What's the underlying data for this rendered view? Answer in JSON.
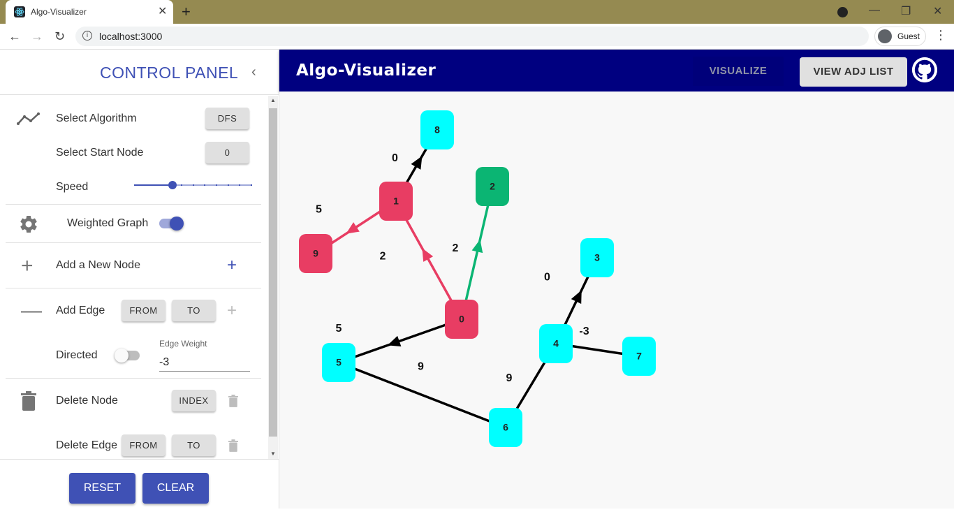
{
  "browser": {
    "tab_title": "Algo-Visualizer",
    "url": "localhost:3000",
    "profile_label": "Guest"
  },
  "control_panel": {
    "title": "CONTROL PANEL",
    "select_algorithm_label": "Select Algorithm",
    "algorithm_value": "DFS",
    "select_start_node_label": "Select Start Node",
    "start_node_value": "0",
    "speed_label": "Speed",
    "speed_level": 3,
    "speed_steps": 10,
    "weighted_graph_label": "Weighted Graph",
    "weighted_graph_on": true,
    "add_node_label": "Add a New Node",
    "add_edge_label": "Add Edge",
    "from_label": "FROM",
    "to_label": "TO",
    "directed_label": "Directed",
    "directed_on": false,
    "edge_weight_label": "Edge Weight",
    "edge_weight_value": "-3",
    "delete_node_label": "Delete Node",
    "index_label": "INDEX",
    "delete_edge_label": "Delete Edge",
    "reset_label": "RESET",
    "clear_label": "CLEAR"
  },
  "appbar": {
    "title": "Algo-Visualizer",
    "visualize_label": "VISUALIZE",
    "adj_list_label": "VIEW ADJ LIST"
  },
  "colors": {
    "accent": "#3f51b5",
    "appbar": "#000080",
    "node_default": "#00ffff",
    "node_visited": "#e83d63",
    "node_current": "#0bb573",
    "edge_default": "#000000"
  },
  "graph": {
    "nodes": [
      {
        "id": "0",
        "state": "visited"
      },
      {
        "id": "1",
        "state": "visited"
      },
      {
        "id": "2",
        "state": "current"
      },
      {
        "id": "3",
        "state": "default"
      },
      {
        "id": "4",
        "state": "default"
      },
      {
        "id": "5",
        "state": "default"
      },
      {
        "id": "6",
        "state": "default"
      },
      {
        "id": "7",
        "state": "default"
      },
      {
        "id": "8",
        "state": "default"
      },
      {
        "id": "9",
        "state": "visited"
      }
    ],
    "edges": [
      {
        "from": "0",
        "to": "1",
        "weight": "2",
        "directed": true,
        "state": "visited"
      },
      {
        "from": "0",
        "to": "2",
        "weight": "2",
        "directed": true,
        "state": "current"
      },
      {
        "from": "1",
        "to": "9",
        "weight": "5",
        "directed": true,
        "state": "visited"
      },
      {
        "from": "1",
        "to": "8",
        "weight": "0",
        "directed": true,
        "state": "default"
      },
      {
        "from": "0",
        "to": "5",
        "weight": "5",
        "directed": true,
        "state": "default"
      },
      {
        "from": "5",
        "to": "6",
        "weight": "9",
        "directed": false,
        "state": "default"
      },
      {
        "from": "6",
        "to": "4",
        "weight": "9",
        "directed": false,
        "state": "default"
      },
      {
        "from": "4",
        "to": "3",
        "weight": "0",
        "directed": true,
        "state": "default"
      },
      {
        "from": "4",
        "to": "7",
        "weight": "-3",
        "directed": false,
        "state": "default"
      }
    ]
  }
}
